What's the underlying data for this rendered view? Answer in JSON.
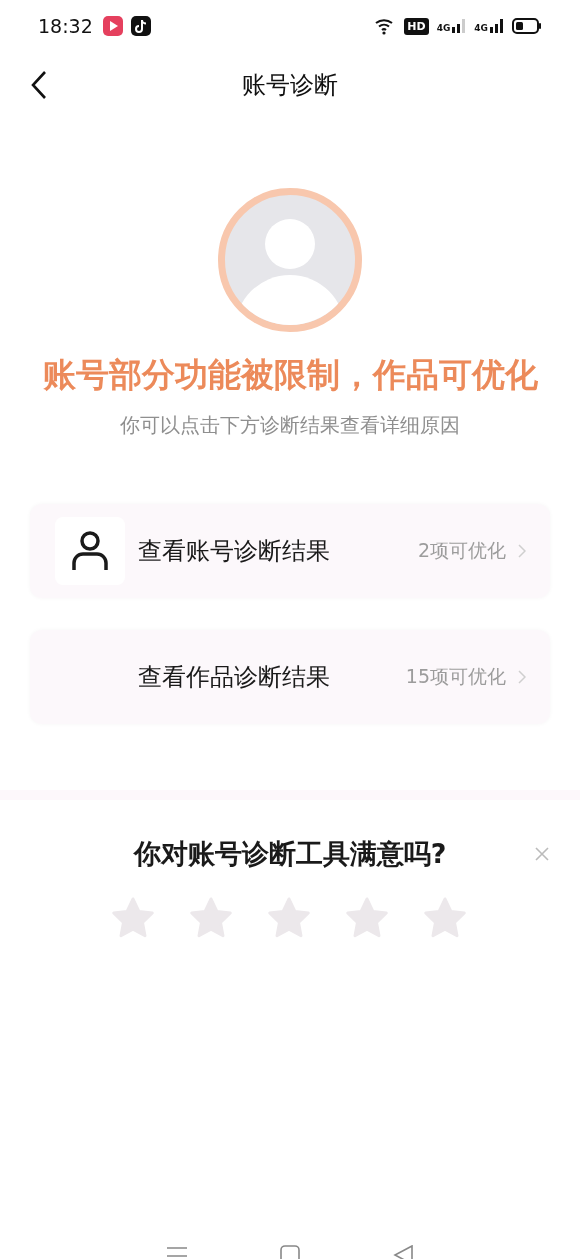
{
  "status_bar": {
    "time": "18:32",
    "hd": "HD",
    "network_1": "4G",
    "network_2": "4G"
  },
  "header": {
    "title": "账号诊断"
  },
  "summary": {
    "headline": "账号部分功能被限制，作品可优化",
    "hint": "你可以点击下方诊断结果查看详细原因"
  },
  "results": [
    {
      "kind": "account",
      "label": "查看账号诊断结果",
      "count": "2项可优化"
    },
    {
      "kind": "works",
      "label": "查看作品诊断结果",
      "count": "15项可优化"
    }
  ],
  "feedback": {
    "question": "你对账号诊断工具满意吗?",
    "stars": 0
  }
}
